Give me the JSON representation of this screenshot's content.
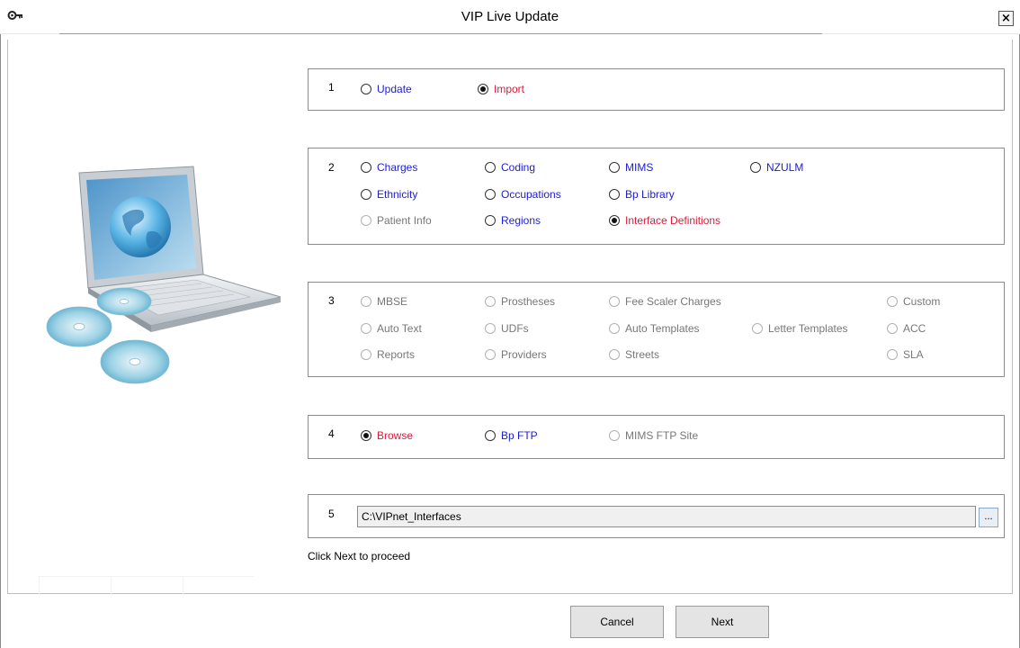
{
  "window": {
    "title": "VIP Live Update",
    "close_label": "×"
  },
  "groups": [
    {
      "number": "1",
      "options": [
        {
          "label": "Update",
          "checked": false,
          "state": "enabled"
        },
        {
          "label": "Import",
          "checked": true,
          "state": "selected"
        }
      ]
    },
    {
      "number": "2",
      "options": [
        {
          "label": "Charges",
          "checked": false,
          "state": "enabled"
        },
        {
          "label": "Coding",
          "checked": false,
          "state": "enabled"
        },
        {
          "label": "MIMS",
          "checked": false,
          "state": "enabled"
        },
        {
          "label": "NZULM",
          "checked": false,
          "state": "enabled"
        },
        {
          "label": "Ethnicity",
          "checked": false,
          "state": "enabled"
        },
        {
          "label": "Occupations",
          "checked": false,
          "state": "enabled"
        },
        {
          "label": "Bp Library",
          "checked": false,
          "state": "enabled"
        },
        {
          "label": "Patient Info",
          "checked": false,
          "state": "disabled"
        },
        {
          "label": "Regions",
          "checked": false,
          "state": "enabled"
        },
        {
          "label": "Interface Definitions",
          "checked": true,
          "state": "selected"
        }
      ]
    },
    {
      "number": "3",
      "options": [
        {
          "label": "MBSE",
          "checked": false,
          "state": "disabled"
        },
        {
          "label": "Prostheses",
          "checked": false,
          "state": "disabled"
        },
        {
          "label": "Fee Scaler Charges",
          "checked": false,
          "state": "disabled"
        },
        {
          "label": "Custom",
          "checked": false,
          "state": "disabled"
        },
        {
          "label": "Auto Text",
          "checked": false,
          "state": "disabled"
        },
        {
          "label": "UDFs",
          "checked": false,
          "state": "disabled"
        },
        {
          "label": "Auto Templates",
          "checked": false,
          "state": "disabled"
        },
        {
          "label": "Letter Templates",
          "checked": false,
          "state": "disabled"
        },
        {
          "label": "ACC",
          "checked": false,
          "state": "disabled"
        },
        {
          "label": "Reports",
          "checked": false,
          "state": "disabled"
        },
        {
          "label": "Providers",
          "checked": false,
          "state": "disabled"
        },
        {
          "label": "Streets",
          "checked": false,
          "state": "disabled"
        },
        {
          "label": "SLA",
          "checked": false,
          "state": "disabled"
        }
      ]
    },
    {
      "number": "4",
      "options": [
        {
          "label": "Browse",
          "checked": true,
          "state": "selected"
        },
        {
          "label": "Bp FTP",
          "checked": false,
          "state": "enabled"
        },
        {
          "label": "MIMS FTP Site",
          "checked": false,
          "state": "disabled"
        }
      ]
    },
    {
      "number": "5",
      "path_value": "C:\\VIPnet_Interfaces",
      "browse_label": "..."
    }
  ],
  "hint": "Click Next to proceed",
  "buttons": {
    "cancel": "Cancel",
    "next": "Next"
  },
  "colors": {
    "enabled": "#1c1cd6",
    "selected": "#e0183a",
    "disabled": "#777777",
    "border": "#8c8c8c"
  },
  "icons": {
    "title": "key-icon",
    "close": "close-icon",
    "illustration": "laptop-globe-illustration"
  }
}
